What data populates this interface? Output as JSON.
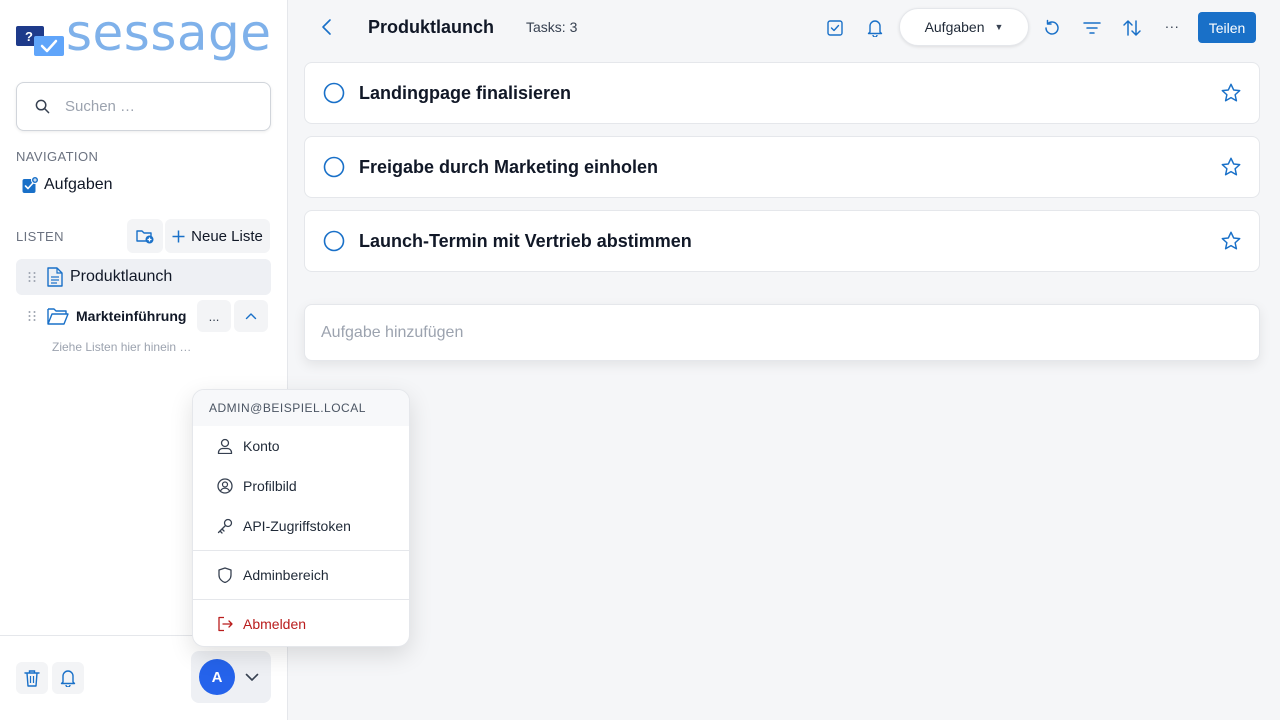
{
  "app": {
    "logo_text": "sessage"
  },
  "sidebar": {
    "search_placeholder": "Suchen …",
    "navigation_label": "NAVIGATION",
    "nav_items": [
      {
        "label": "Aufgaben",
        "icon": "tasks-icon"
      }
    ],
    "lists_label": "LISTEN",
    "new_list_label": "Neue Liste",
    "lists": [
      {
        "label": "Produktlaunch",
        "icon": "document-icon",
        "active": true
      },
      {
        "label": "Markteinführung",
        "icon": "folder-icon",
        "active": false,
        "more_label": "..."
      }
    ],
    "drop_hint": "Ziehe Listen hier hinein …",
    "user_initial": "A"
  },
  "user_menu": {
    "email": "ADMIN@BEISPIEL.LOCAL",
    "items": [
      {
        "label": "Konto",
        "icon": "user-icon"
      },
      {
        "label": "Profilbild",
        "icon": "profile-picture-icon"
      },
      {
        "label": "API-Zugriffstoken",
        "icon": "key-icon"
      },
      {
        "label": "Adminbereich",
        "icon": "shield-icon"
      },
      {
        "label": "Abmelden",
        "icon": "logout-icon"
      }
    ]
  },
  "header": {
    "title": "Produktlaunch",
    "task_count": "Tasks: 3",
    "view_select": "Aufgaben",
    "more_label": "...",
    "share_label": "Teilen"
  },
  "tasks": [
    {
      "title": "Landingpage finalisieren",
      "done": false,
      "starred": false
    },
    {
      "title": "Freigabe durch Marketing einholen",
      "done": false,
      "starred": false
    },
    {
      "title": "Launch-Termin mit Vertrieb abstimmen",
      "done": false,
      "starred": false
    }
  ],
  "add_task_placeholder": "Aufgabe hinzufügen",
  "colors": {
    "accent": "#1970c8",
    "avatar": "#2563eb",
    "logo": "#7fb1ea",
    "danger": "#b91c1c"
  }
}
